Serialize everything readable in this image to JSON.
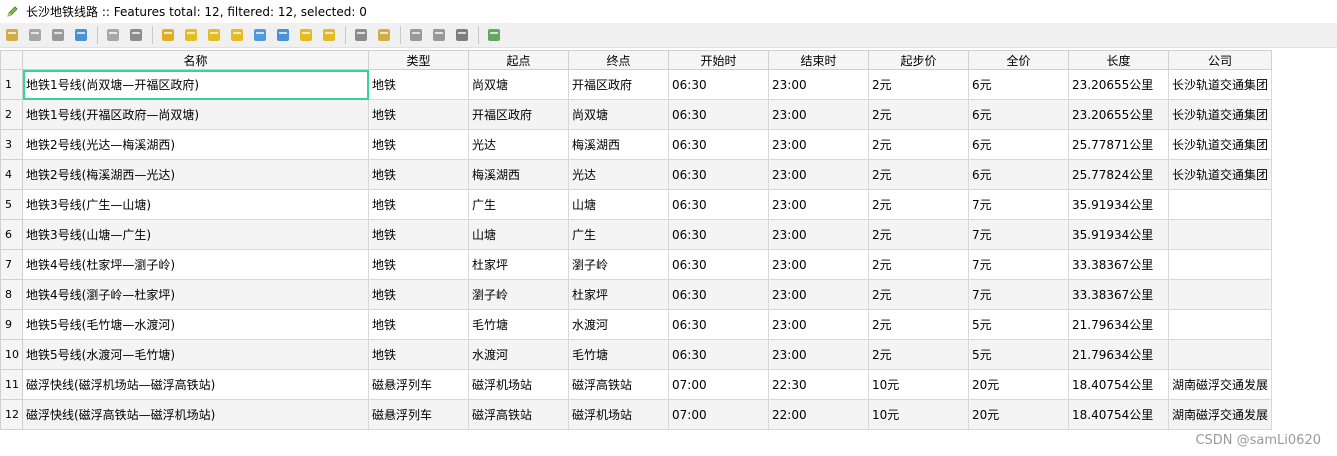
{
  "window": {
    "title": "长沙地铁线路 :: Features total: 12, filtered: 12, selected: 0"
  },
  "toolbar": {
    "buttons": [
      {
        "name": "toggle-editing-icon",
        "color": "#c9a227"
      },
      {
        "name": "multi-edit-icon",
        "color": "#9a9a9a"
      },
      {
        "name": "save-edits-icon",
        "color": "#8a8a8a"
      },
      {
        "name": "reload-icon",
        "color": "#2f7fd1"
      },
      {
        "name": "add-feature-icon",
        "color": "#9a9a9a"
      },
      {
        "name": "delete-selected-icon",
        "color": "#7a7a7a"
      },
      {
        "name": "select-by-expression-icon",
        "color": "#d9a400"
      },
      {
        "name": "select-all-icon",
        "color": "#e2b400"
      },
      {
        "name": "invert-selection-icon",
        "color": "#e2b400"
      },
      {
        "name": "deselect-all-icon",
        "color": "#e2b400"
      },
      {
        "name": "filter-select-icon",
        "color": "#3a8ad9"
      },
      {
        "name": "move-selection-top-icon",
        "color": "#2f7fd1"
      },
      {
        "name": "pan-to-selected-icon",
        "color": "#e0b000"
      },
      {
        "name": "zoom-to-selected-icon",
        "color": "#e0b000"
      },
      {
        "name": "copy-rows-icon",
        "color": "#7a7a7a"
      },
      {
        "name": "paste-features-icon",
        "color": "#c9a227"
      },
      {
        "name": "delete-field-icon",
        "color": "#8a8a8a"
      },
      {
        "name": "new-field-icon",
        "color": "#8a8a8a"
      },
      {
        "name": "field-calculator-icon",
        "color": "#6a6a6a"
      },
      {
        "name": "conditional-formatting-icon",
        "color": "#4a9a4a"
      }
    ]
  },
  "table": {
    "columns": [
      "名称",
      "类型",
      "起点",
      "终点",
      "开始时",
      "结束时",
      "起步价",
      "全价",
      "长度",
      "公司"
    ],
    "rows": [
      {
        "num": "1",
        "cells": [
          "地铁1号线(尚双塘—开福区政府)",
          "地铁",
          "尚双塘",
          "开福区政府",
          "06:30",
          "23:00",
          "2元",
          "6元",
          "23.20655公里",
          "长沙轨道交通集团"
        ]
      },
      {
        "num": "2",
        "cells": [
          "地铁1号线(开福区政府—尚双塘)",
          "地铁",
          "开福区政府",
          "尚双塘",
          "06:30",
          "23:00",
          "2元",
          "6元",
          "23.20655公里",
          "长沙轨道交通集团"
        ]
      },
      {
        "num": "3",
        "cells": [
          "地铁2号线(光达—梅溪湖西)",
          "地铁",
          "光达",
          "梅溪湖西",
          "06:30",
          "23:00",
          "2元",
          "6元",
          "25.77871公里",
          "长沙轨道交通集团"
        ]
      },
      {
        "num": "4",
        "cells": [
          "地铁2号线(梅溪湖西—光达)",
          "地铁",
          "梅溪湖西",
          "光达",
          "06:30",
          "23:00",
          "2元",
          "6元",
          "25.77824公里",
          "长沙轨道交通集团"
        ]
      },
      {
        "num": "5",
        "cells": [
          "地铁3号线(广生—山塘)",
          "地铁",
          "广生",
          "山塘",
          "06:30",
          "23:00",
          "2元",
          "7元",
          "35.91934公里",
          ""
        ]
      },
      {
        "num": "6",
        "cells": [
          "地铁3号线(山塘—广生)",
          "地铁",
          "山塘",
          "广生",
          "06:30",
          "23:00",
          "2元",
          "7元",
          "35.91934公里",
          ""
        ]
      },
      {
        "num": "7",
        "cells": [
          "地铁4号线(杜家坪—瀏子岭)",
          "地铁",
          "杜家坪",
          "瀏子岭",
          "06:30",
          "23:00",
          "2元",
          "7元",
          "33.38367公里",
          ""
        ]
      },
      {
        "num": "8",
        "cells": [
          "地铁4号线(瀏子岭—杜家坪)",
          "地铁",
          "瀏子岭",
          "杜家坪",
          "06:30",
          "23:00",
          "2元",
          "7元",
          "33.38367公里",
          ""
        ]
      },
      {
        "num": "9",
        "cells": [
          "地铁5号线(毛竹塘—水渡河)",
          "地铁",
          "毛竹塘",
          "水渡河",
          "06:30",
          "23:00",
          "2元",
          "5元",
          "21.79634公里",
          ""
        ]
      },
      {
        "num": "10",
        "cells": [
          "地铁5号线(水渡河—毛竹塘)",
          "地铁",
          "水渡河",
          "毛竹塘",
          "06:30",
          "23:00",
          "2元",
          "5元",
          "21.79634公里",
          ""
        ]
      },
      {
        "num": "11",
        "cells": [
          "磁浮快线(磁浮机场站—磁浮高铁站)",
          "磁悬浮列车",
          "磁浮机场站",
          "磁浮高铁站",
          "07:00",
          "22:30",
          "10元",
          "20元",
          "18.40754公里",
          "湖南磁浮交通发展"
        ]
      },
      {
        "num": "12",
        "cells": [
          "磁浮快线(磁浮高铁站—磁浮机场站)",
          "磁悬浮列车",
          "磁浮高铁站",
          "磁浮机场站",
          "07:00",
          "22:00",
          "10元",
          "20元",
          "18.40754公里",
          "湖南磁浮交通发展"
        ]
      }
    ]
  },
  "watermark": "CSDN @samLi0620"
}
